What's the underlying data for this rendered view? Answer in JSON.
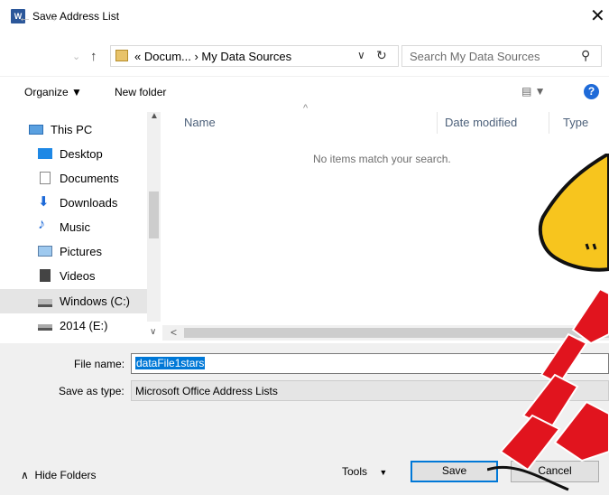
{
  "window": {
    "title": "Save Address List",
    "app_icon": "word-icon",
    "close_symbol": "✕"
  },
  "address": {
    "path": "« Docum... › My Data Sources"
  },
  "search": {
    "placeholder": "Search My Data Sources"
  },
  "toolbar": {
    "organize": "Organize ▼",
    "new_folder": "New folder",
    "view_symbol": "▤ ▼",
    "help_symbol": "?"
  },
  "nav": {
    "items": [
      {
        "label": "This PC",
        "icon": "pc-icon"
      },
      {
        "label": "Desktop",
        "icon": "desktop-icon"
      },
      {
        "label": "Documents",
        "icon": "documents-icon"
      },
      {
        "label": "Downloads",
        "icon": "downloads-icon"
      },
      {
        "label": "Music",
        "icon": "music-icon"
      },
      {
        "label": "Pictures",
        "icon": "pictures-icon"
      },
      {
        "label": "Videos",
        "icon": "videos-icon"
      },
      {
        "label": "Windows (C:)",
        "icon": "drive-icon",
        "selected": true
      },
      {
        "label": "2014 (E:)",
        "icon": "removable-drive-icon"
      }
    ]
  },
  "files": {
    "columns": [
      "Name",
      "Date modified",
      "Type"
    ],
    "empty_message": "No items match your search."
  },
  "form": {
    "file_name_label": "File name:",
    "file_name_value": "dataFile1stars",
    "save_type_label": "Save as type:",
    "save_type_value": "Microsoft Office Address Lists"
  },
  "footer": {
    "hide_folders": "Hide Folders",
    "tools": "Tools",
    "save": "Save",
    "cancel": "Cancel"
  },
  "colors": {
    "accent": "#0078d7",
    "word_blue": "#2b579a",
    "sticker_red": "#e1141e",
    "sticker_yellow": "#f7c51e"
  }
}
